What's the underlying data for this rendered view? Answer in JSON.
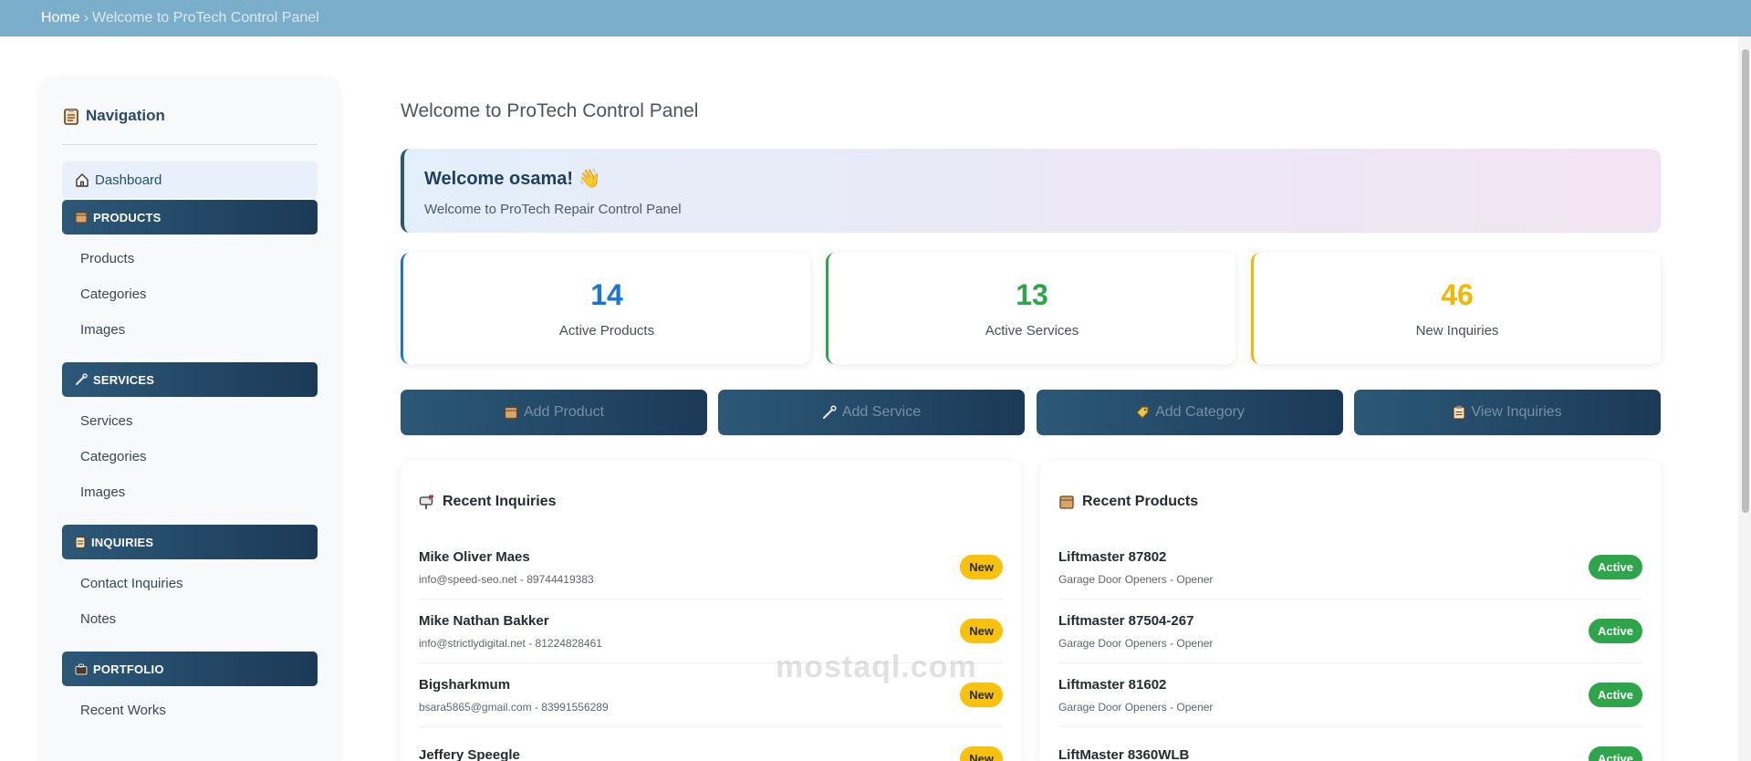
{
  "breadcrumb": {
    "home": "Home",
    "separator": "›",
    "current": "Welcome to ProTech Control Panel"
  },
  "sidebar": {
    "title": "Navigation",
    "dashboard": "Dashboard",
    "sections": [
      {
        "label": "PRODUCTS",
        "icon": "box-icon",
        "items": [
          "Products",
          "Categories",
          "Images"
        ]
      },
      {
        "label": "SERVICES",
        "icon": "wrench-icon",
        "items": [
          "Services",
          "Categories",
          "Images"
        ]
      },
      {
        "label": "INQUIRIES",
        "icon": "clipboard-icon",
        "items": [
          "Contact Inquiries",
          "Notes"
        ]
      },
      {
        "label": "PORTFOLIO",
        "icon": "briefcase-icon",
        "items": [
          "Recent Works"
        ]
      }
    ]
  },
  "main": {
    "title": "Welcome to ProTech Control Panel",
    "welcome_title": "Welcome osama! 👋",
    "welcome_sub": "Welcome to ProTech Repair Control Panel",
    "stats": [
      {
        "value": "14",
        "label": "Active Products",
        "color": "#1877d6"
      },
      {
        "value": "13",
        "label": "Active Services",
        "color": "#2ea54a"
      },
      {
        "value": "46",
        "label": "New Inquiries",
        "color": "#f2b705"
      }
    ],
    "actions": [
      {
        "label": "Add Product",
        "icon": "box-icon"
      },
      {
        "label": "Add Service",
        "icon": "wrench-icon"
      },
      {
        "label": "Add Category",
        "icon": "tag-icon"
      },
      {
        "label": "View Inquiries",
        "icon": "clipboard-icon"
      }
    ]
  },
  "recent_inquiries": {
    "title": "Recent Inquiries",
    "rows": [
      {
        "name": "Mike Oliver Maes",
        "meta": "info@speed-seo.net - 89744419383",
        "status": "New"
      },
      {
        "name": "Mike Nathan Bakker",
        "meta": "info@strictlydigital.net - 81224828461",
        "status": "New"
      },
      {
        "name": "Bigsharkmum",
        "meta": "bsara5865@gmail.com - 83991556289",
        "status": "New"
      },
      {
        "name": "Jeffery Speegle",
        "meta": "",
        "status": "New"
      }
    ]
  },
  "recent_products": {
    "title": "Recent Products",
    "rows": [
      {
        "name": "Liftmaster 87802",
        "meta": "Garage Door Openers - Opener",
        "status": "Active"
      },
      {
        "name": "Liftmaster 87504-267",
        "meta": "Garage Door Openers - Opener",
        "status": "Active"
      },
      {
        "name": "Liftmaster 81602",
        "meta": "Garage Door Openers - Opener",
        "status": "Active"
      },
      {
        "name": "LiftMaster 8360WLB",
        "meta": "",
        "status": "Active"
      }
    ]
  },
  "watermark": "mostaql.com"
}
